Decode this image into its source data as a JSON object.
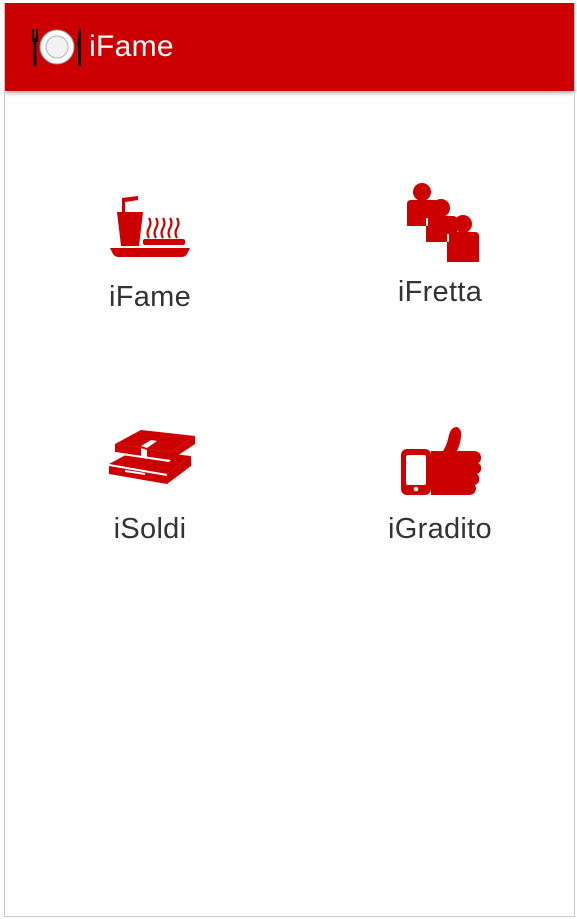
{
  "app": {
    "title": "iFame",
    "logo_icon": "plate-fork-knife-icon",
    "bar_color": "#cc0000"
  },
  "menu": {
    "accent_color": "#cc0000",
    "items": [
      {
        "label": "iFame",
        "icon": "meal-tray-icon"
      },
      {
        "label": "iFretta",
        "icon": "people-queue-icon"
      },
      {
        "label": "iSoldi",
        "icon": "money-stack-icon"
      },
      {
        "label": "iGradito",
        "icon": "phone-thumbs-up-icon"
      }
    ]
  }
}
